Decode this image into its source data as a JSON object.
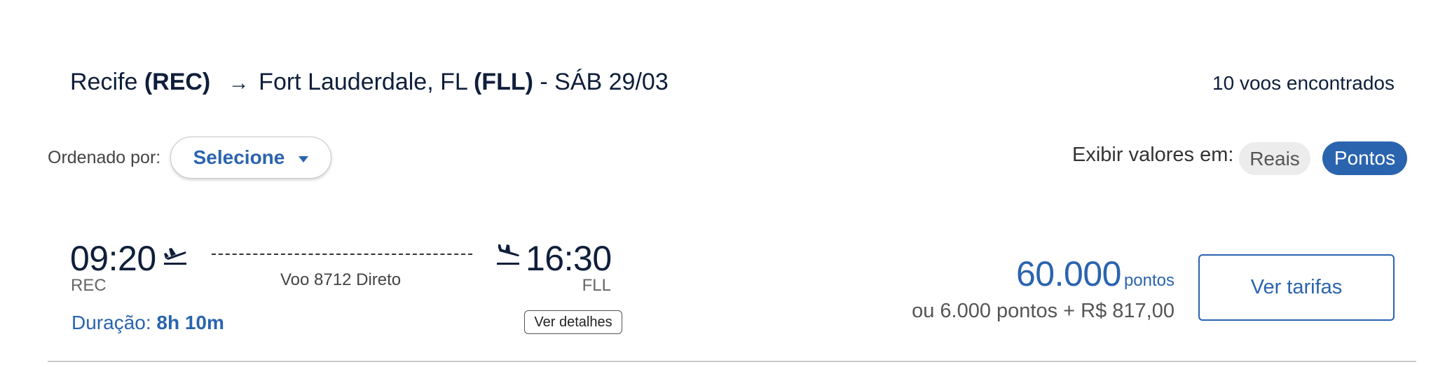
{
  "header": {
    "origin_city": "Recife",
    "origin_code": "(REC)",
    "arrow": "→",
    "destination_city": "Fort Lauderdale, FL",
    "destination_code": "(FLL)",
    "date_text": "- SÁB 29/03",
    "results_count": "10 voos encontrados"
  },
  "sort": {
    "label": "Ordenado por:",
    "selected": "Selecione"
  },
  "display_values": {
    "label": "Exibir valores em:",
    "options": [
      "Reais",
      "Pontos"
    ],
    "active": "Pontos"
  },
  "flight": {
    "departure_time": "09:20",
    "departure_code": "REC",
    "arrival_time": "16:30",
    "arrival_code": "FLL",
    "info": "Voo 8712 Direto",
    "duration_label": "Duração:",
    "duration_value": "8h 10m",
    "details_button": "Ver detalhes",
    "price_points": "60.000",
    "price_unit": "pontos",
    "price_alternative": "ou 6.000 pontos + R$ 817,00",
    "fares_button": "Ver tarifas"
  },
  "colors": {
    "accent": "#2a64ae",
    "text_dark": "#0f1e3a",
    "divider": "#c8c8c8"
  },
  "icons": {
    "departure": "plane-takeoff-icon",
    "arrival": "plane-landing-icon",
    "sort_caret": "caret-down-icon"
  }
}
